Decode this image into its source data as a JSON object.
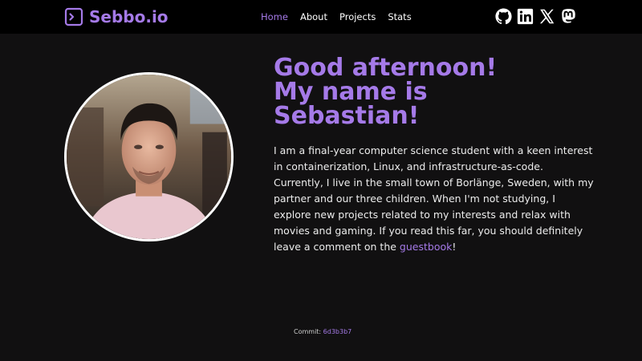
{
  "brand": {
    "name": "Sebbo.io",
    "icon": "terminal-icon"
  },
  "nav": {
    "items": [
      {
        "label": "Home",
        "active": true
      },
      {
        "label": "About",
        "active": false
      },
      {
        "label": "Projects",
        "active": false
      },
      {
        "label": "Stats",
        "active": false
      }
    ]
  },
  "socials": [
    "github-icon",
    "linkedin-icon",
    "x-icon",
    "mastodon-icon"
  ],
  "hero": {
    "line1": "Good afternoon!",
    "line2": "My name is",
    "line3": "Sebastian!",
    "bio_text": "I am a final-year computer science student with a keen interest in containerization, Linux, and infrastructure-as-code. Currently, I live in the small town of Borlänge, Sweden, with my partner and our three children. When I'm not studying, I explore new projects related to my interests and relax with movies and gaming. If you read this far, you should definitely leave a comment on the",
    "bio_link": "guestbook",
    "bio_end": "!"
  },
  "footer": {
    "commit_label": "Commit:",
    "commit_hash": "6d3b3b7"
  },
  "colors": {
    "accent": "#a57ae8",
    "background": "#111011",
    "navbar": "#000000"
  }
}
